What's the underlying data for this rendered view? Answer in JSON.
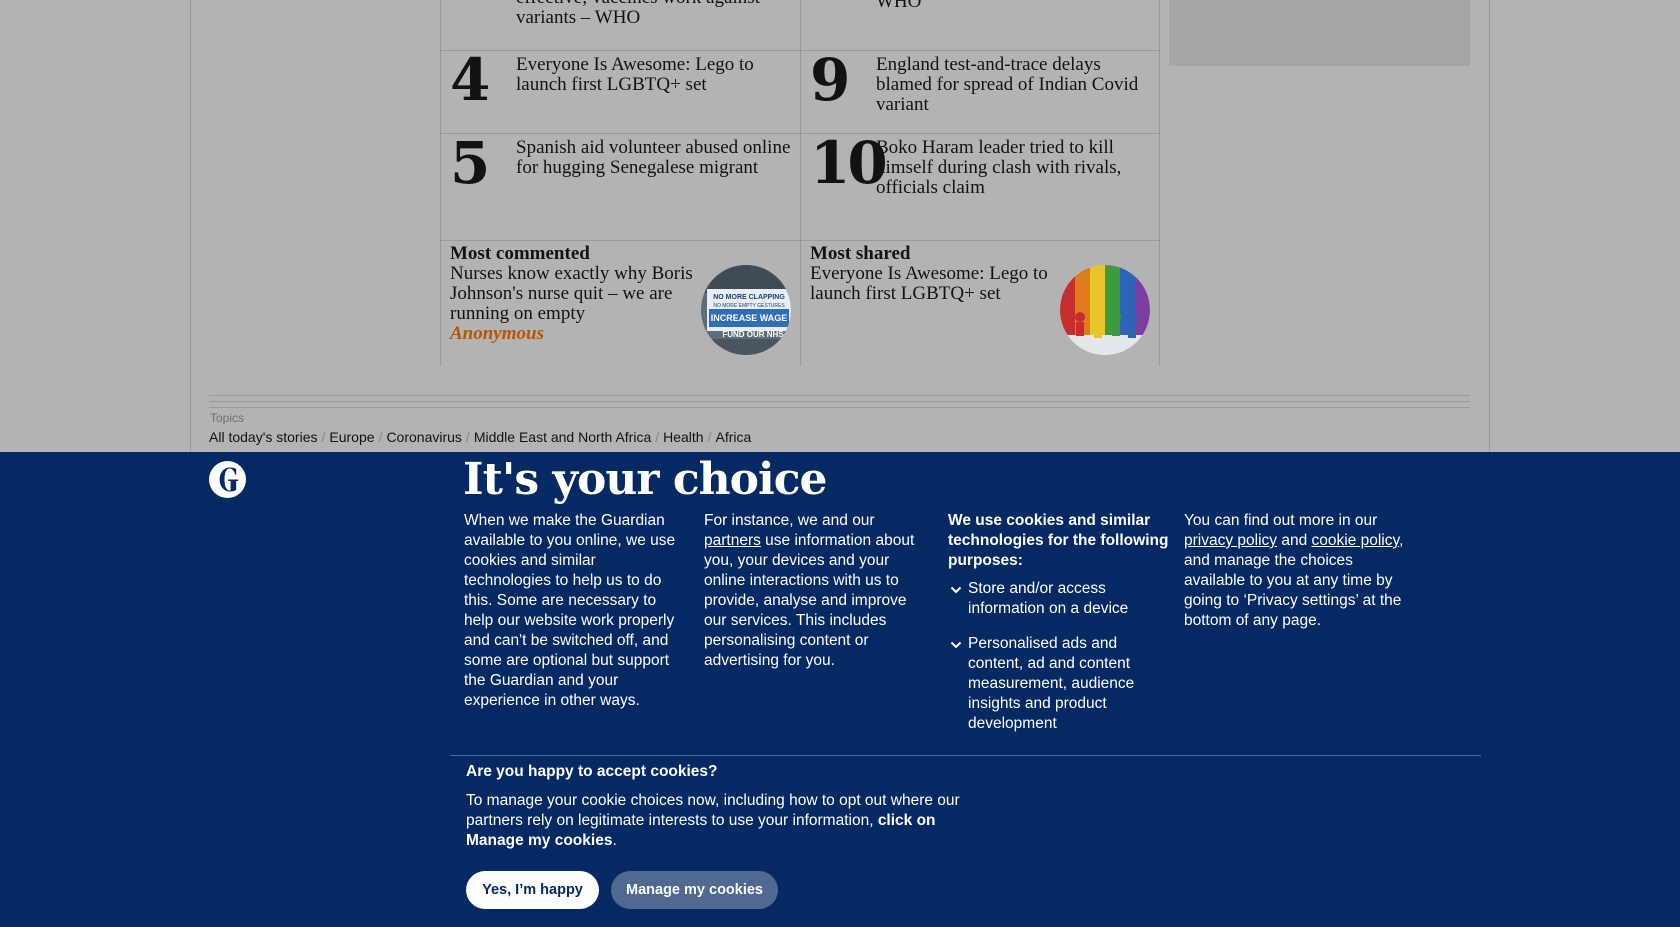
{
  "most_popular": {
    "items": [
      {
        "rank": "",
        "headline": "effective; vaccines work against variants – WHO"
      },
      {
        "rank": "",
        "headline": "WHO"
      },
      {
        "rank": "4",
        "headline": "Everyone Is Awesome: Lego to launch first LGBTQ+ set"
      },
      {
        "rank": "9",
        "headline": "England test-and-trace delays blamed for spread of Indian Covid variant"
      },
      {
        "rank": "5",
        "headline": "Spanish aid volunteer abused online for hugging Senegalese migrant"
      },
      {
        "rank": "10",
        "headline": "Boko Haram leader tried to kill himself during clash with rivals, officials claim"
      }
    ]
  },
  "most_commented": {
    "label": "Most commented",
    "headline": "Nurses know exactly why Boris Johnson's nurse quit – we are running on empty",
    "author": "Anonymous",
    "image_icon": "protest-sign-image"
  },
  "most_shared": {
    "label": "Most shared",
    "headline": "Everyone Is Awesome: Lego to launch first LGBTQ+ set",
    "image_icon": "rainbow-lego-image"
  },
  "topics": {
    "label": "Topics",
    "items": [
      "All today's stories",
      "Europe",
      "Coronavirus",
      "Middle East and North Africa",
      "Health",
      "Africa"
    ]
  },
  "consent": {
    "title": "It's your choice",
    "col1": "When we make the Guardian available to you online, we use cookies and similar technologies to help us to do this. Some are necessary to help our website work properly and can't be switched off, and some are optional but support the Guardian and your experience in other ways.",
    "col2_pre": "For instance, we and our ",
    "col2_link": "partners",
    "col2_post": " use information about you, your devices and your online interactions with us to provide, analyse and improve our services. This includes personalising content or advertising for you.",
    "purposes_head": "We use cookies and similar technologies for the following purposes:",
    "purposes": [
      "Store and/or access information on a device",
      "Personalised ads and content, ad and content measurement, audience insights and product development"
    ],
    "col4_pre": "You can find out more in our ",
    "col4_link1": "privacy policy",
    "col4_mid": " and ",
    "col4_link2": "cookie policy",
    "col4_post": ", and manage the choices available to you at any time by going to ‘Privacy settings’ at the bottom of any page.",
    "question": "Are you happy to accept cookies?",
    "question_body": "To manage your cookie choices now, including how to opt out where our partners rely on legitimate interests to use your information, ",
    "question_bold": "click on Manage my cookies",
    "question_end": ".",
    "accept_label": "Yes, I’m happy",
    "manage_label": "Manage my cookies"
  },
  "colors": {
    "banner_bg": "#052962",
    "page_dim": "#b3b3b3",
    "author_accent": "#b85500",
    "manage_btn": "#506991"
  }
}
